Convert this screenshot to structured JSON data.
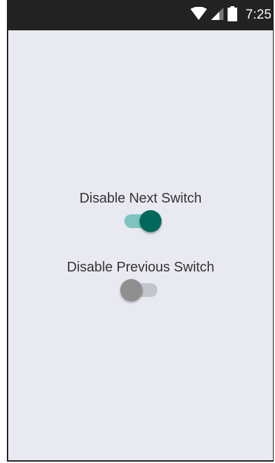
{
  "status_bar": {
    "time": "7:25",
    "icons": [
      "wifi-icon",
      "cellular-signal-icon",
      "battery-icon"
    ]
  },
  "switches": [
    {
      "label": "Disable Next Switch",
      "checked": true,
      "colors": {
        "track": "#7fc3bf",
        "thumb": "#00695c"
      }
    },
    {
      "label": "Disable Previous Switch",
      "checked": false,
      "colors": {
        "track": "#c4c4cc",
        "thumb": "#8f8f8f"
      }
    }
  ],
  "theme": {
    "background": "#e9e9f2",
    "status_bar_background": "#222222",
    "text_color": "#333333"
  }
}
